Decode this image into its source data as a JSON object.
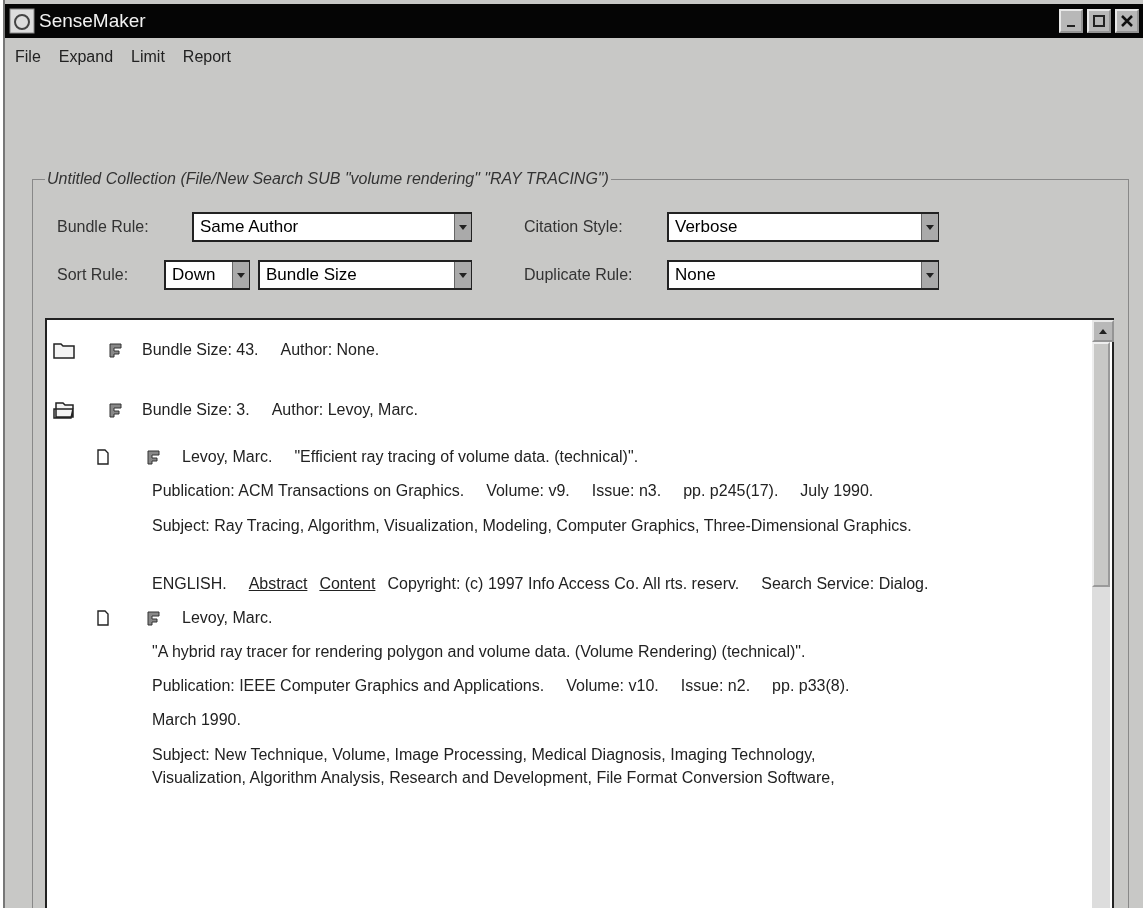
{
  "window": {
    "title": "SenseMaker"
  },
  "menu": [
    "File",
    "Expand",
    "Limit",
    "Report"
  ],
  "collection": {
    "title": "Untitled Collection (File/New Search SUB \"volume rendering\" \"RAY TRACING\")",
    "control_rows": [
      [
        {
          "label": "Bundle Rule:",
          "dropdowns": [
            "Same Author"
          ]
        },
        {
          "label": "Citation Style:",
          "dropdowns": [
            "Verbose"
          ]
        }
      ],
      [
        {
          "label": "Sort Rule:",
          "dropdowns": [
            "Down",
            "Bundle Size"
          ]
        },
        {
          "label": "Duplicate Rule:",
          "dropdowns": [
            "None"
          ]
        }
      ]
    ],
    "tree": [
      {
        "kind": "bundle",
        "expanded": false,
        "heading": [
          "Bundle Size: 43.",
          "Author: None."
        ]
      },
      {
        "kind": "bundle",
        "expanded": true,
        "heading": [
          "Bundle Size: 3.",
          "Author: Levoy, Marc."
        ],
        "children": [
          {
            "kind": "record",
            "heading": [
              "Levoy, Marc.",
              "\"Efficient ray tracing of volume data. (technical)\"."
            ],
            "lines": [
              {
                "kind": "line",
                "parts": [
                  {
                    "kind": "text",
                    "text": "Publication: ACM Transactions on Graphics."
                  },
                  {
                    "kind": "text",
                    "text": "Volume: v9."
                  },
                  {
                    "kind": "text",
                    "text": "Issue: n3."
                  },
                  {
                    "kind": "text",
                    "text": "pp. p245(17)."
                  },
                  {
                    "kind": "text",
                    "text": "July 1990."
                  }
                ]
              },
              {
                "kind": "paragraph",
                "text": "Subject: Ray Tracing, Algorithm, Visualization, Modeling, Computer Graphics, Three-Dimensional Graphics."
              },
              {
                "kind": "line",
                "parts": [
                  {
                    "kind": "text",
                    "text": "ENGLISH."
                  },
                  {
                    "kind": "link",
                    "text": "Abstract"
                  },
                  {
                    "kind": "link",
                    "text": "Content"
                  },
                  {
                    "kind": "text",
                    "text": "Copyright: (c) 1997 Info Access Co. All rts. reserv."
                  },
                  {
                    "kind": "text",
                    "text": "Search Service: Dialog."
                  }
                ]
              }
            ]
          },
          {
            "kind": "record",
            "heading": [
              "Levoy, Marc."
            ],
            "lines": [
              {
                "kind": "line",
                "parts": [
                  {
                    "kind": "text",
                    "text": "\"A hybrid ray tracer for rendering polygon and volume data. (Volume Rendering) (technical)\"."
                  }
                ]
              },
              {
                "kind": "line",
                "parts": [
                  {
                    "kind": "text",
                    "text": "Publication: IEEE Computer Graphics and Applications."
                  },
                  {
                    "kind": "text",
                    "text": "Volume: v10."
                  },
                  {
                    "kind": "text",
                    "text": "Issue: n2."
                  },
                  {
                    "kind": "text",
                    "text": "pp. p33(8)."
                  }
                ]
              },
              {
                "kind": "line",
                "parts": [
                  {
                    "kind": "text",
                    "text": "March 1990."
                  }
                ]
              },
              {
                "kind": "paragraph",
                "text": "Subject: New Technique, Volume, Image Processing, Medical Diagnosis, Imaging Technology, Visualization, Algorithm Analysis, Research and Development, File Format Conversion Software,"
              }
            ]
          }
        ]
      }
    ]
  }
}
